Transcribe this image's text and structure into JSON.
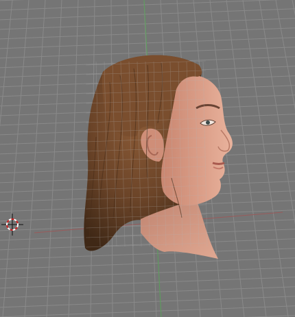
{
  "viewport": {
    "view": "3d-perspective",
    "background_color": "#757575",
    "grid_color": "#8a8a8a",
    "x_axis_color": "#9a5a5a",
    "y_axis_color": "#5aa05a"
  },
  "scene": {
    "object": "human-head-model",
    "hair_color": "#6b4428",
    "skin_color": "#d79a82",
    "cursor": "3d-cursor-icon"
  }
}
